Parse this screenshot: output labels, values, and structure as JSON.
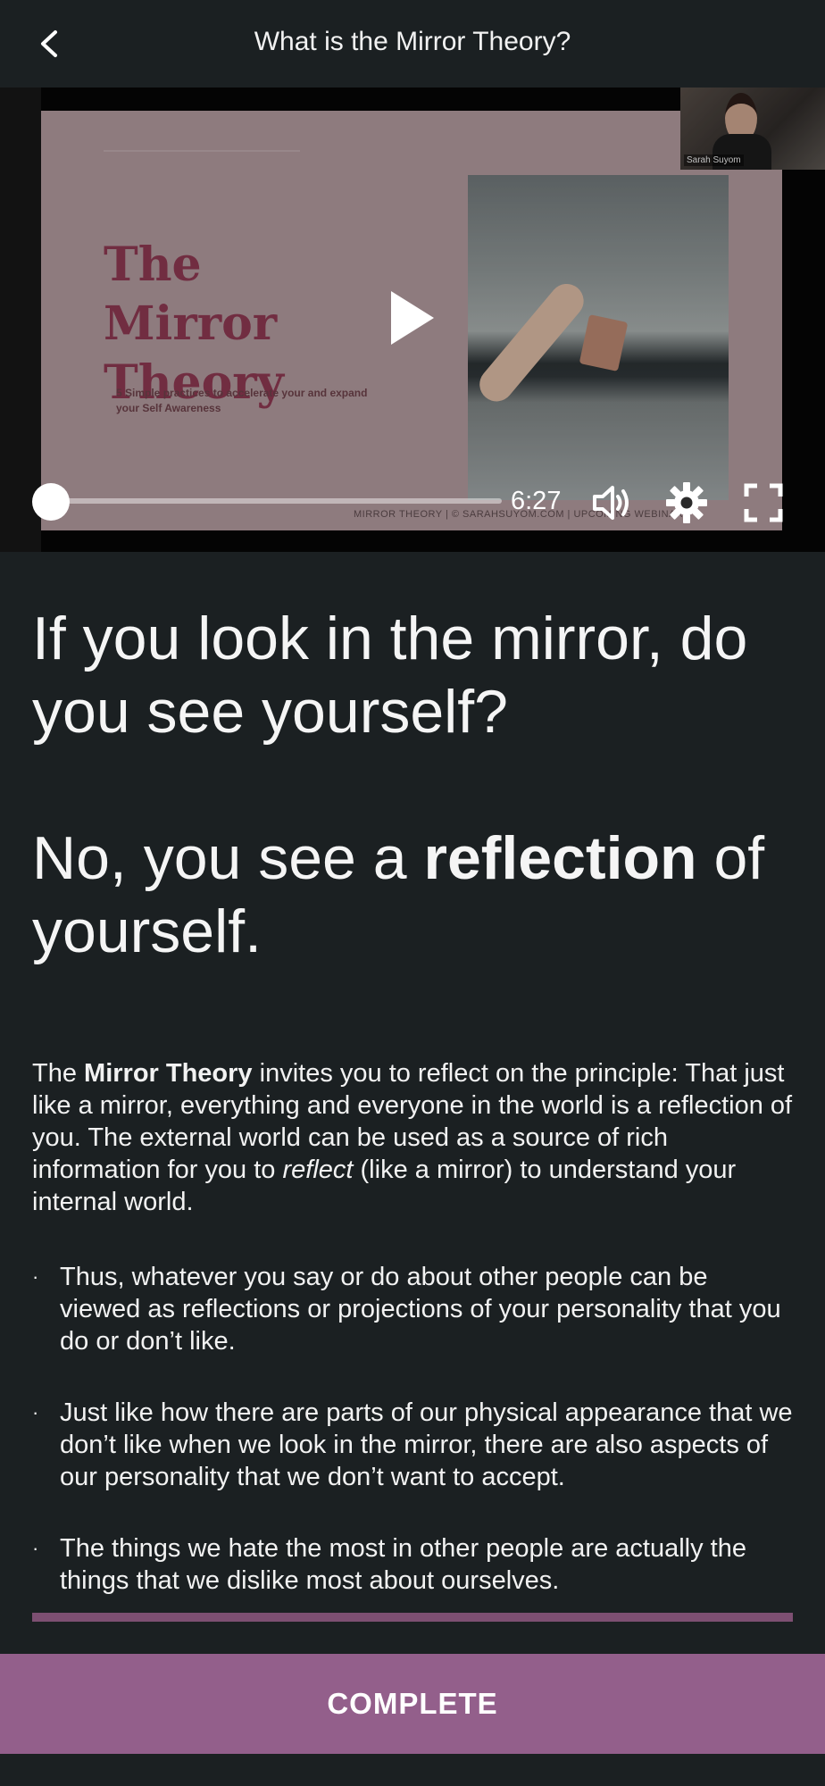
{
  "header": {
    "title": "What is the Mirror Theory?",
    "back_icon": "chevron-left-icon"
  },
  "video": {
    "slide_title": "The Mirror Theory",
    "slide_subtitle": "5 Simple practices to accelerate your and expand your Self Awareness",
    "slide_footer": "MIRROR THEORY | © SARAHSUYOM.COM | UPCOMING WEBINAR",
    "webcam_name": "Sarah Suyom",
    "time": "6:27",
    "progress": 0.0,
    "icons": {
      "play": "play-icon",
      "volume": "volume-icon",
      "settings": "gear-icon",
      "fullscreen": "fullscreen-icon"
    }
  },
  "content": {
    "headline_1": "If you look in the mirror, do you see yourself?",
    "headline_2_prefix": "No, you see a ",
    "headline_2_bold": "reflection",
    "headline_2_suffix": " of yourself.",
    "para_prefix": "The ",
    "para_bold": "Mirror Theory",
    "para_mid": " invites you to reflect on the principle: That just like a mirror, everything and everyone in the world is a reflection of you. The external world can be used as a source of rich information for you to ",
    "para_italic": "reflect",
    "para_suffix": " (like a mirror) to understand your internal world.",
    "bullet_char": "·",
    "bullets": [
      "Thus, whatever you say or do about other people can be viewed as reflections or projections of your personality that you do or don’t like.",
      "Just like how there are parts of our physical appearance that we don’t like when we look in the mirror, there are also aspects of our personality that we don’t want to accept.",
      "The things we hate the most in other people are actually the things that we dislike most about ourselves."
    ]
  },
  "footer": {
    "complete_label": "COMPLETE"
  },
  "colors": {
    "background": "#1b2022",
    "accent": "#935f8b",
    "divider": "#7d4f72",
    "slide_title": "#8a3750"
  }
}
